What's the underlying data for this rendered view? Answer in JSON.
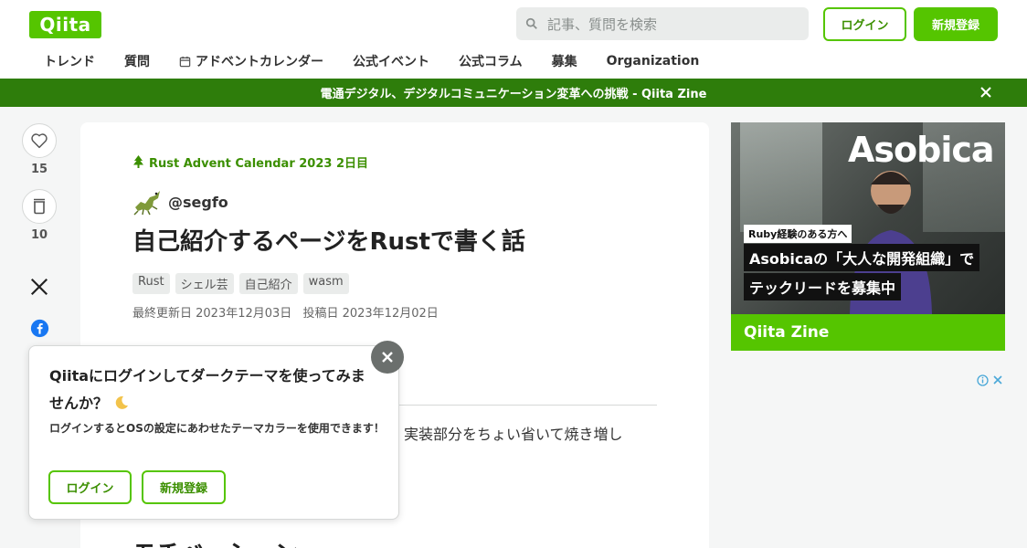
{
  "header": {
    "logo": "Qiita",
    "search_placeholder": "記事、質問を検索",
    "login_label": "ログイン",
    "signup_label": "新規登録",
    "nav": [
      "トレンド",
      "質問",
      "アドベントカレンダー",
      "公式イベント",
      "公式コラム",
      "募集",
      "Organization"
    ]
  },
  "banner": {
    "text": "電通デジタル、デジタルコミュニケーション変革への挑戦 - Qiita Zine"
  },
  "actions": {
    "like_count": "15",
    "stock_count": "10"
  },
  "article": {
    "advent_calendar": "Rust Advent Calendar 2023 2日目",
    "author": "@segfo",
    "title": "自己紹介するページをRustで書く話",
    "tags": [
      "Rust",
      "シェル芸",
      "自己紹介",
      "wasm"
    ],
    "updated": "最終更新日 2023年12月03日",
    "posted": "投稿日 2023年12月02日",
    "body_excerpt": "、実装部分をちょい省いて焼き増し",
    "heading": "モチベーション"
  },
  "popup": {
    "title": "Qiitaにログインしてダークテーマを使ってみませんか？",
    "description": "ログインするとOSの設定にあわせたテーマカラーを使用できます！",
    "login_label": "ログイン",
    "signup_label": "新規登録"
  },
  "ad": {
    "brand": "Asobica",
    "chip": "Ruby経験のある方へ",
    "line1": "Asobicaの「大人な開発組織」で",
    "line2": "テックリードを募集中",
    "footer": "Qiita Zine"
  },
  "colors": {
    "accent": "#55c500",
    "banner": "#2e7d0b",
    "background": "#f5f6f6"
  }
}
